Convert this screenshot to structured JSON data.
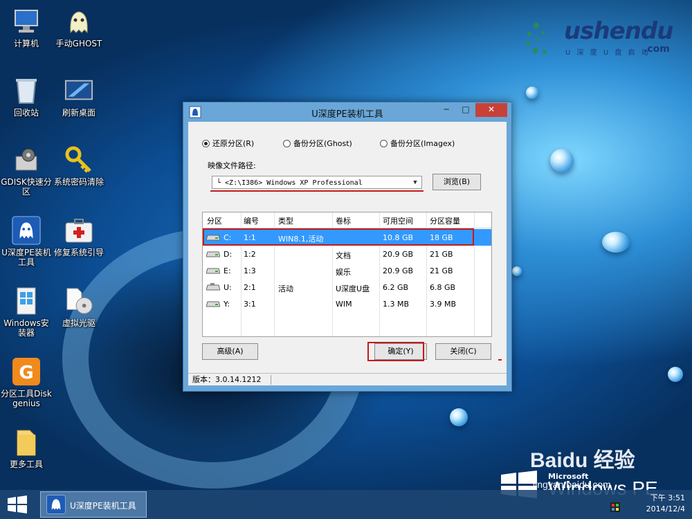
{
  "desktop": {
    "icons": [
      {
        "label": "计算机"
      },
      {
        "label": "手动GHOST"
      },
      {
        "label": "回收站"
      },
      {
        "label": "刷新桌面"
      },
      {
        "label": "GDISK快速分区"
      },
      {
        "label": "系统密码清除"
      },
      {
        "label": "U深度PE装机工具"
      },
      {
        "label": "修复系统引导"
      },
      {
        "label": "Windows安装器"
      },
      {
        "label": "虚拟光驱"
      },
      {
        "label": "分区工具Diskgenius"
      },
      {
        "label": "更多工具"
      }
    ]
  },
  "logo": {
    "brand": "ushendu",
    "sub": "U 深 度 U 盘 启 动",
    "domain": ".com"
  },
  "dialog": {
    "title": "U深度PE装机工具",
    "minimize": "─",
    "maximize": "□",
    "close": "✕",
    "radios": [
      {
        "label": "还原分区(R)",
        "checked": true
      },
      {
        "label": "备份分区(Ghost)",
        "checked": false
      },
      {
        "label": "备份分区(Imagex)",
        "checked": false
      }
    ],
    "image_path_label": "映像文件路径:",
    "image_path_value": "└ <Z:\\I386> Windows XP Professional",
    "browse_button": "浏览(B)",
    "table": {
      "columns": [
        "分区",
        "编号",
        "类型",
        "卷标",
        "可用空间",
        "分区容量"
      ],
      "rows": [
        {
          "drive": "C:",
          "num": "1:1",
          "type": "WIN8.1,活动",
          "label": "",
          "free": "10.8 GB",
          "size": "18 GB",
          "selected": true
        },
        {
          "drive": "D:",
          "num": "1:2",
          "type": "",
          "label": "文档",
          "free": "20.9 GB",
          "size": "21 GB",
          "selected": false
        },
        {
          "drive": "E:",
          "num": "1:3",
          "type": "",
          "label": "娱乐",
          "free": "20.9 GB",
          "size": "21 GB",
          "selected": false
        },
        {
          "drive": "U:",
          "num": "2:1",
          "type": "活动",
          "label": "U深度U盘",
          "free": "6.2 GB",
          "size": "6.8 GB",
          "selected": false
        },
        {
          "drive": "Y:",
          "num": "3:1",
          "type": "",
          "label": "WIM",
          "free": "1.3 MB",
          "size": "3.9 MB",
          "selected": false
        }
      ]
    },
    "advanced_button": "高级(A)",
    "ok_button": "确定(Y)",
    "close_button": "关闭(C)",
    "version": "版本：3.0.14.1212"
  },
  "taskbar": {
    "task_label": "U深度PE装机工具",
    "time": "下午 3:51",
    "date": "2014/12/4"
  },
  "branding": {
    "microsoft": "Microsoft",
    "windows_pe": "Windows PE",
    "baidu": "Baidu 经验",
    "baidu_url": "jingyan.baidu.com"
  },
  "colors": {
    "selection": "#3399ff",
    "highlight_red": "#c41a1a",
    "taskbar": "#1e4673"
  }
}
